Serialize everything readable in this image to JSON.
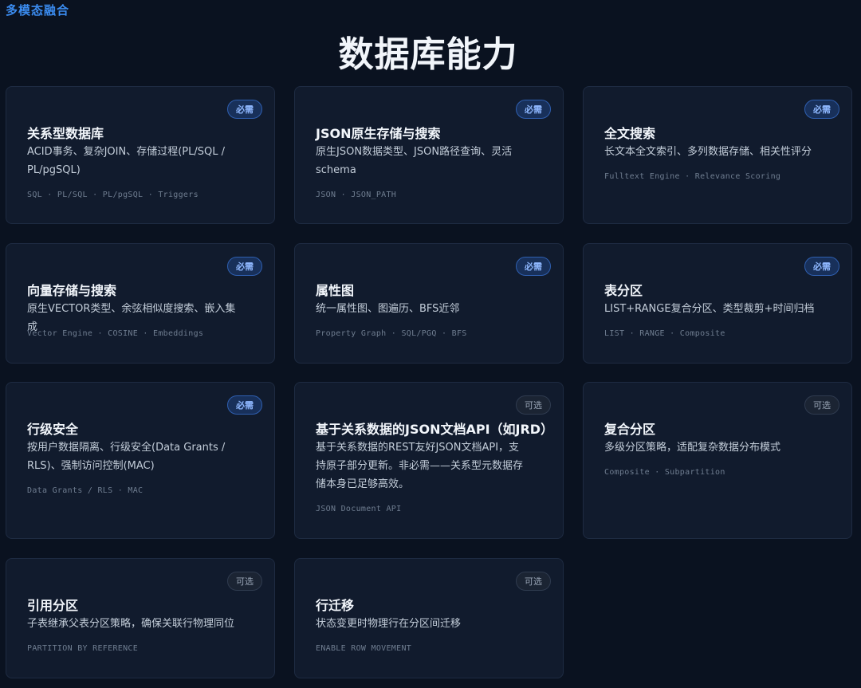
{
  "header": {
    "tag": "多模态融合",
    "title": "数据库能力"
  },
  "cards": [
    {
      "title": "关系型数据库",
      "badge": "必需",
      "description": "ACID事务、复杂JOIN、存储过程(PL/SQL / PL/pgSQL)",
      "tags": "SQL · PL/SQL · PL/pgSQL · Triggers"
    },
    {
      "title": "JSON原生存储与搜索",
      "badge": "必需",
      "description": "原生JSON数据类型、JSON路径查询、灵活schema",
      "tags": "JSON · JSON_PATH"
    },
    {
      "title": "全文搜索",
      "badge": "必需",
      "description": "长文本全文索引、多列数据存储、相关性评分",
      "tags": "Fulltext Engine · Relevance Scoring"
    },
    {
      "title": "向量存储与搜索",
      "badge": "必需",
      "description": "原生VECTOR类型、余弦相似度搜索、嵌入集成",
      "tags": "Vector Engine · COSINE · Embeddings"
    },
    {
      "title": "属性图",
      "badge": "必需",
      "description": "统一属性图、图遍历、BFS近邻",
      "tags": "Property Graph · SQL/PGQ · BFS"
    },
    {
      "title": "表分区",
      "badge": "必需",
      "description": "LIST+RANGE复合分区、类型裁剪+时间归档",
      "tags": "LIST · RANGE · Composite"
    },
    {
      "title": "行级安全",
      "badge": "必需",
      "description": "按用户数据隔离、行级安全(Data Grants / RLS)、强制访问控制(MAC)",
      "tags": "Data Grants / RLS · MAC"
    },
    {
      "title": "基于关系数据的JSON文档API（如JRD）",
      "badge": "可选",
      "description": "基于关系数据的REST友好JSON文档API，支持原子部分更新。非必需——关系型元数据存储本身已足够高效。",
      "tags": "JSON Document API"
    },
    {
      "title": "复合分区",
      "badge": "可选",
      "description": "多级分区策略，适配复杂数据分布模式",
      "tags": "Composite · Subpartition"
    },
    {
      "title": "引用分区",
      "badge": "可选",
      "description": "子表继承父表分区策略，确保关联行物理同位",
      "tags": "PARTITION BY REFERENCE"
    },
    {
      "title": "行迁移",
      "badge": "可选",
      "description": "状态变更时物理行在分区间迁移",
      "tags": "ENABLE ROW MOVEMENT"
    }
  ]
}
